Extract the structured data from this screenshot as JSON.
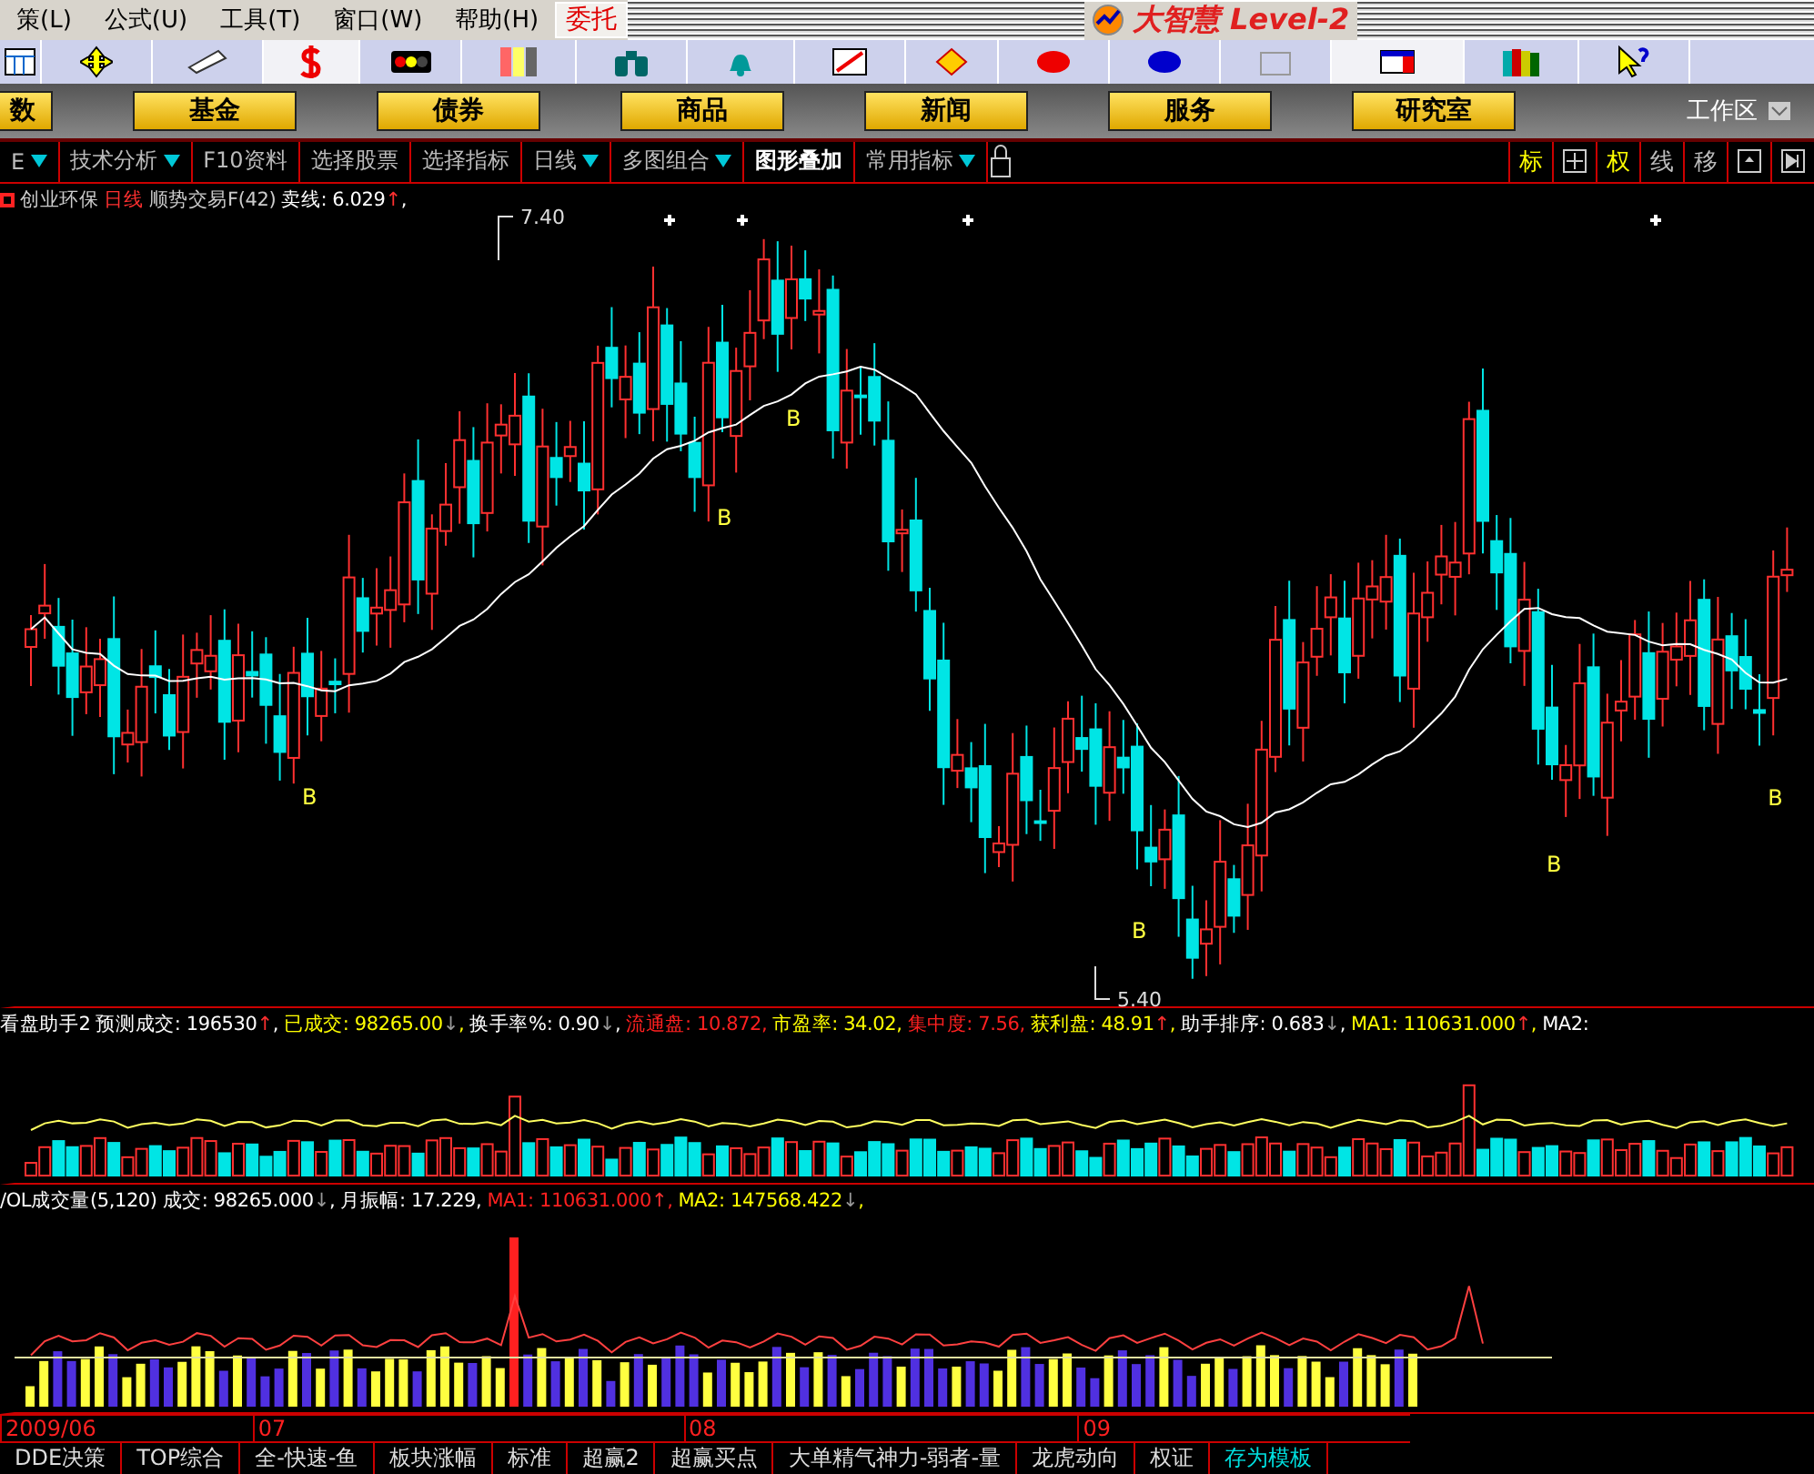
{
  "menu": [
    {
      "label": "策(L)"
    },
    {
      "label": "公式(U)"
    },
    {
      "label": "工具(T)"
    },
    {
      "label": "窗口(W)"
    },
    {
      "label": "帮助(H)"
    }
  ],
  "trade_button": "委托",
  "app_title": "大智慧 Level-2",
  "nav_buttons": [
    "数",
    "基金",
    "债券",
    "商品",
    "新闻",
    "服务",
    "研究室"
  ],
  "workspace": "工作区",
  "chart_toolbar": [
    {
      "label": "E",
      "dropdown": true,
      "selected": false
    },
    {
      "label": "技术分析",
      "dropdown": true,
      "selected": false
    },
    {
      "label": "F10资料",
      "dropdown": false,
      "selected": false
    },
    {
      "label": "选择股票",
      "dropdown": false,
      "selected": false
    },
    {
      "label": "选择指标",
      "dropdown": false,
      "selected": false
    },
    {
      "label": "日线",
      "dropdown": true,
      "selected": false
    },
    {
      "label": "多图组合",
      "dropdown": true,
      "selected": false
    },
    {
      "label": "图形叠加",
      "dropdown": false,
      "selected": true
    },
    {
      "label": "常用指标",
      "dropdown": true,
      "selected": false
    }
  ],
  "chart_tools": [
    {
      "kind": "text",
      "label": "标",
      "on": true
    },
    {
      "kind": "crosshair"
    },
    {
      "kind": "text",
      "label": "权",
      "on": true
    },
    {
      "kind": "text",
      "label": "线",
      "on": false
    },
    {
      "kind": "text",
      "label": "移",
      "on": false
    },
    {
      "kind": "window"
    },
    {
      "kind": "next"
    }
  ],
  "main_chart": {
    "stock": "创业环保",
    "period": "日线",
    "indicator": "顺势交易F(42)",
    "sell_line": "卖线: 6.029",
    "sell_arrow": "↑",
    "sell_suffix": ",",
    "high_label": "7.40",
    "low_label": "5.40",
    "markers": [
      {
        "text": "B"
      },
      {
        "text": "B"
      },
      {
        "text": "B"
      },
      {
        "text": "B"
      },
      {
        "text": "B"
      },
      {
        "text": "B"
      }
    ]
  },
  "assistant_pane": {
    "title": "看盘助手2",
    "items": [
      {
        "text": "预测成交: 196530",
        "arrow": "↑",
        "rising": true,
        "suffix": ",",
        "color": "#ffffff"
      },
      {
        "text": "已成交: 98265.00",
        "arrow": "↓",
        "rising": false,
        "suffix": ",",
        "color": "#ffff00"
      },
      {
        "text": "换手率%: 0.90",
        "arrow": "↓",
        "rising": false,
        "suffix": ",",
        "color": "#ffffff"
      },
      {
        "text": "流通盘: 10.872,",
        "color": "#ff2020"
      },
      {
        "text": "市盈率: 34.02,",
        "color": "#ffff00"
      },
      {
        "text": "集中度: 7.56,",
        "color": "#ff2020"
      },
      {
        "text": "获利盘: 48.91",
        "arrow": "↑",
        "rising": true,
        "suffix": ",",
        "color": "#ffff00"
      },
      {
        "text": "助手排序: 0.683",
        "arrow": "↓",
        "rising": false,
        "suffix": ",",
        "color": "#ffffff"
      },
      {
        "text": "MA1: 110631.000",
        "arrow": "↑",
        "rising": true,
        "suffix": ",",
        "color": "#ffff00"
      },
      {
        "text": "MA2:",
        "color": "#ffffff"
      }
    ]
  },
  "volume_pane": {
    "title": "/OL成交量(5,120)",
    "items": [
      {
        "text": "成交: 98265.000",
        "arrow": "↓",
        "rising": false,
        "suffix": ",",
        "color": "#ffffff"
      },
      {
        "text": "月振幅: 17.229,",
        "color": "#ffffff"
      },
      {
        "text": "MA1: 110631.000",
        "arrow": "↑",
        "rising": true,
        "suffix": ",",
        "color": "#ff2020"
      },
      {
        "text": "MA2: 147568.422",
        "arrow": "↓",
        "rising": false,
        "suffix": ",",
        "color": "#ffff00"
      }
    ]
  },
  "x_axis": [
    "2009/06",
    "07",
    "08",
    "09"
  ],
  "bottom_tabs": [
    {
      "label": "DDE决策",
      "selected": false
    },
    {
      "label": "TOP综合",
      "selected": false
    },
    {
      "label": "全-快速-鱼",
      "selected": false
    },
    {
      "label": "板块涨幅",
      "selected": false
    },
    {
      "label": "标准",
      "selected": false
    },
    {
      "label": "超赢2",
      "selected": false
    },
    {
      "label": "超赢买点",
      "selected": false
    },
    {
      "label": "大单精气神力-弱者-量",
      "selected": false
    },
    {
      "label": "龙虎动向",
      "selected": false
    },
    {
      "label": "权证",
      "selected": false
    },
    {
      "label": "存为模板",
      "selected": true
    }
  ]
}
